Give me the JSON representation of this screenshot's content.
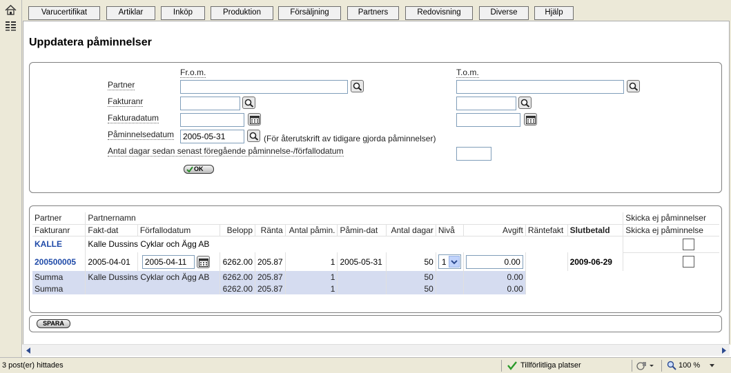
{
  "tabs": [
    {
      "label": "Varucertifikat"
    },
    {
      "label": "Artiklar"
    },
    {
      "label": "Inköp"
    },
    {
      "label": "Produktion"
    },
    {
      "label": "Försäljning"
    },
    {
      "label": "Partners"
    },
    {
      "label": "Redovisning"
    },
    {
      "label": "Diverse"
    },
    {
      "label": "Hjälp"
    }
  ],
  "page": {
    "title": "Uppdatera påminnelser"
  },
  "filter": {
    "from_label": "Fr.o.m.",
    "to_label": "T.o.m.",
    "partner_label": "Partner",
    "fakturanr_label": "Fakturanr",
    "fakturadatum_label": "Fakturadatum",
    "paminnelsedatum_label": "Påminnelsedatum",
    "paminnelsedatum_value": "2005-05-31",
    "paminnelsedatum_note": "(För återutskrift av tidigare gjorda påminnelser)",
    "antal_dagar_label": "Antal dagar sedan senast föregående påminnelse-/förfallodatum",
    "ok_label": "OK"
  },
  "table": {
    "header1": {
      "partner": "Partner",
      "partnernamn": "Partnernamn",
      "skicka": "Skicka ej påminnelser"
    },
    "header2": {
      "fakturanr": "Fakturanr",
      "faktdat": "Fakt-dat",
      "forfallodatum": "Förfallodatum",
      "belopp": "Belopp",
      "ranta": "Ränta",
      "antal_pamin": "Antal påmin.",
      "pamin_dat": "Påmin-dat",
      "antal_dagar": "Antal dagar",
      "niva": "Nivå",
      "avgift": "Avgift",
      "rantefakt": "Räntefakt",
      "slutbetald": "Slutbetald",
      "skicka": "Skicka ej påminnelse"
    },
    "partner_row": {
      "partner": "KALLE",
      "name": "Kalle Dussins Cyklar och Ägg AB"
    },
    "invoice_row": {
      "fakturanr": "200500005",
      "faktdat": "2005-04-01",
      "forfallodatum": "2005-04-11",
      "belopp": "6262.00",
      "ranta": "205.87",
      "antal_pamin": "1",
      "pamin_dat": "2005-05-31",
      "antal_dagar": "50",
      "niva": "1",
      "avgift": "0.00",
      "slutbetald": "2009-06-29"
    },
    "sum_rows": [
      {
        "label": "Summa",
        "name": "Kalle Dussins Cyklar och Ägg AB",
        "belopp": "6262.00",
        "ranta": "205.87",
        "antal_pamin": "1",
        "antal_dagar": "50",
        "avgift": "0.00"
      },
      {
        "label": "Summa",
        "name": "",
        "belopp": "6262.00",
        "ranta": "205.87",
        "antal_pamin": "1",
        "antal_dagar": "50",
        "avgift": "0.00"
      }
    ]
  },
  "spara_label": "SPARA",
  "status": {
    "text": "3 post(er) hittades",
    "zone": "Tillförlitliga platser",
    "zoom": "100 %"
  }
}
